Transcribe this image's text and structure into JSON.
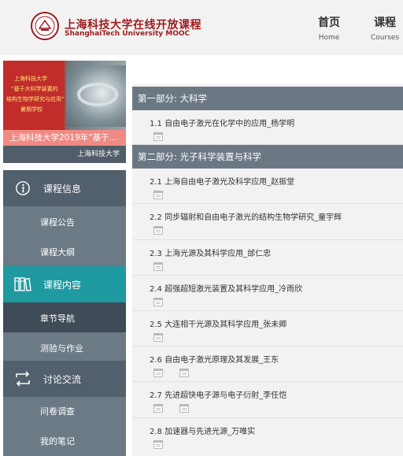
{
  "header": {
    "logo_cn": "上海科技大学在线开放课程",
    "logo_en": "ShanghaiTech  University MOOC",
    "nav": [
      {
        "cn": "首页",
        "en": "Home"
      },
      {
        "cn": "课程",
        "en": "Courses"
      }
    ]
  },
  "banner": {
    "lines": [
      "上海科技大学",
      "“基于大科学装置的",
      "结构生物学研究与应用”",
      "暑期学校"
    ],
    "title": "上海科技大学2019年“基于...",
    "org": "上海科技大学"
  },
  "sidebar": {
    "info_label": "课程信息",
    "info_items": [
      "课程公告",
      "课程大纲"
    ],
    "content_label": "课程内容",
    "content_items": [
      "章节导航",
      "测验与作业"
    ],
    "discuss_label": "讨论交流",
    "discuss_items": [
      "问卷调查",
      "我的笔记"
    ]
  },
  "parts": [
    {
      "title": "第一部分:  大科学"
    },
    {
      "title": "第二部分:  光子科学装置与科学"
    }
  ],
  "lessons": [
    {
      "title": "1.1 自由电子激光在化学中的应用_杨学明"
    },
    {
      "title": "2.1 上海自由电子激光及科学应用_赵振堂"
    },
    {
      "title": "2.2 同步辐射和自由电子激光的结构生物学研究_童宇辉"
    },
    {
      "title": "2.3 上海光源及其科学应用_邰仁忠"
    },
    {
      "title": "2.4 超强超短激光装置及其科学应用_冷雨欣"
    },
    {
      "title": "2.5 大连相干光源及其科学应用_张未卿"
    },
    {
      "title": "2.6 自由电子激光原理及其发展_王东"
    },
    {
      "title": "2.7 先进超快电子源与电子衍射_李任恺"
    },
    {
      "title": "2.8 加速器与先进光源_万唯实"
    }
  ],
  "colors": {
    "brand": "#9b1b1e",
    "sidebar_section": "#525f6c",
    "sidebar_active": "#1e9aa0",
    "sidebar_item": "#6c7a86",
    "part_header": "#6b7884"
  }
}
